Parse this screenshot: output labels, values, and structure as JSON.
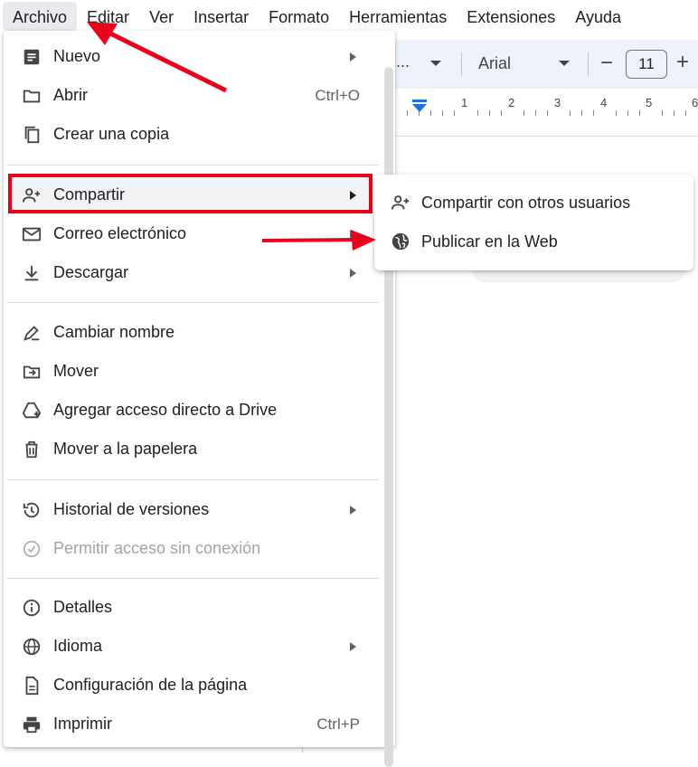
{
  "menubar": {
    "items": [
      "Archivo",
      "Editar",
      "Ver",
      "Insertar",
      "Formato",
      "Herramientas",
      "Extensiones",
      "Ayuda"
    ]
  },
  "toolbar": {
    "style_placeholder": "...",
    "font": "Arial",
    "font_size": "11",
    "minus": "−",
    "plus": "+"
  },
  "ruler": {
    "numbers": [
      "1",
      "2",
      "3",
      "4",
      "5",
      "6"
    ]
  },
  "file_menu": {
    "nuevo": "Nuevo",
    "abrir": "Abrir",
    "abrir_shortcut": "Ctrl+O",
    "copia": "Crear una copia",
    "compartir": "Compartir",
    "correo": "Correo electrónico",
    "descargar": "Descargar",
    "renombrar": "Cambiar nombre",
    "mover": "Mover",
    "acceso_directo": "Agregar acceso directo a Drive",
    "papelera": "Mover a la papelera",
    "historial": "Historial de versiones",
    "sin_conexion": "Permitir acceso sin conexión",
    "detalles": "Detalles",
    "idioma": "Idioma",
    "config_pagina": "Configuración de la página",
    "imprimir": "Imprimir",
    "imprimir_shortcut": "Ctrl+P"
  },
  "share_submenu": {
    "compartir_usuarios": "Compartir con otros usuarios",
    "publicar_web": "Publicar en la Web"
  },
  "colors": {
    "annotation_red": "#e8001c",
    "toolbar_bg": "#eef2fa",
    "ruler_marker": "#1a73e8"
  }
}
